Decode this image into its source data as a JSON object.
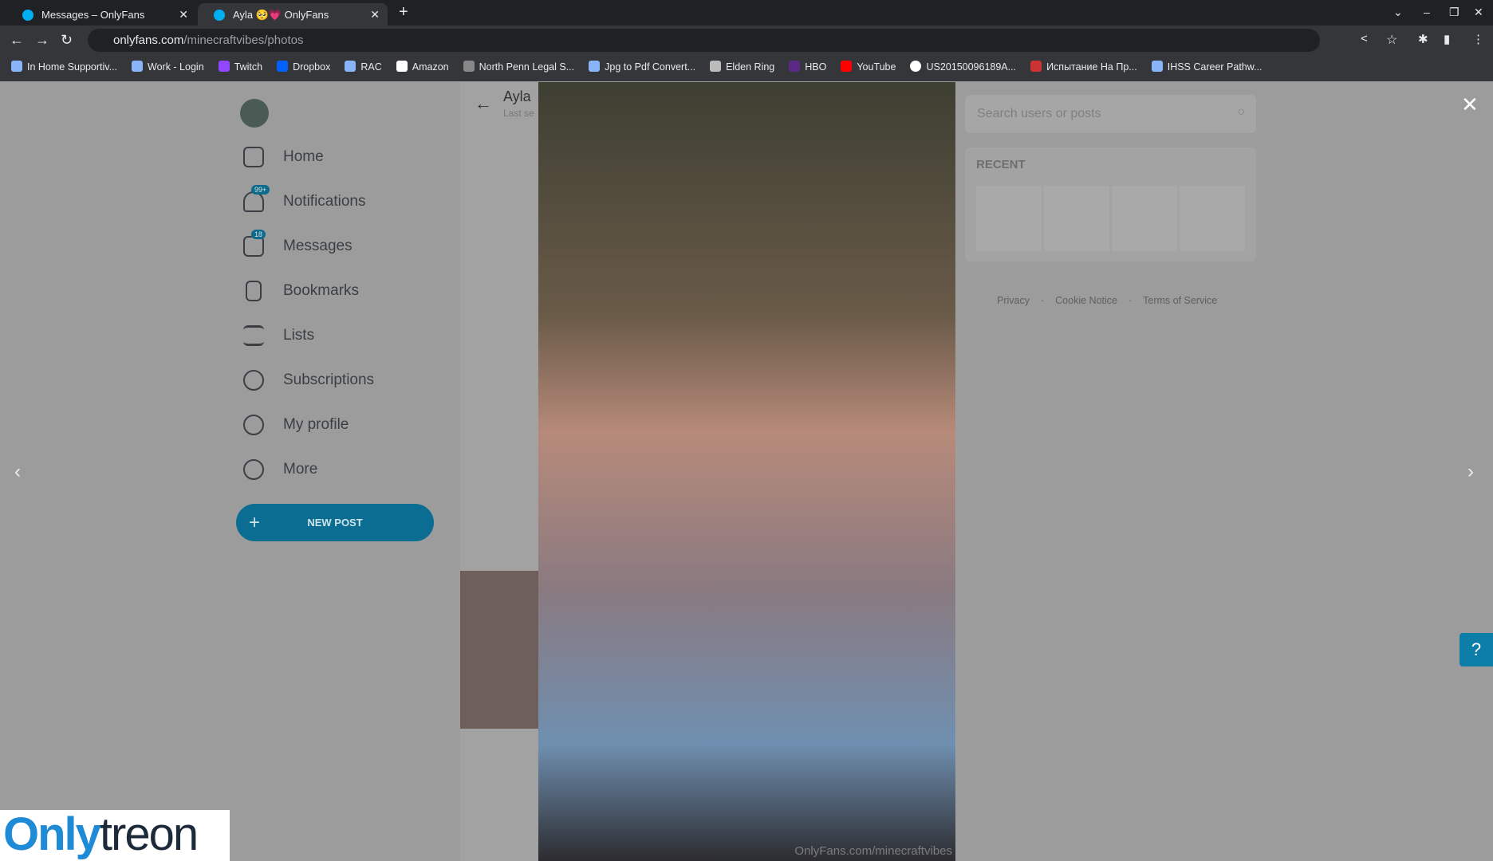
{
  "browser": {
    "tabs": [
      {
        "title": "Messages – OnlyFans"
      },
      {
        "title": "Ayla 🥺💗 OnlyFans"
      }
    ],
    "url_host": "onlyfans.com",
    "url_path": "/minecraftvibes/photos",
    "bookmarks": [
      "In Home Supportiv...",
      "Work - Login",
      "Twitch",
      "Dropbox",
      "RAC",
      "Amazon",
      "North Penn Legal S...",
      "Jpg to Pdf Convert...",
      "Elden Ring",
      "HBO",
      "YouTube",
      "US20150096189A...",
      "Испытание На Пр...",
      "IHSS Career Pathw..."
    ]
  },
  "sidebar": {
    "items": [
      {
        "label": "Home"
      },
      {
        "label": "Notifications",
        "badge": "99+"
      },
      {
        "label": "Messages",
        "badge": "18"
      },
      {
        "label": "Bookmarks"
      },
      {
        "label": "Lists"
      },
      {
        "label": "Subscriptions"
      },
      {
        "label": "My profile"
      },
      {
        "label": "More"
      }
    ],
    "new_post": "NEW POST"
  },
  "profile": {
    "name": "Ayla",
    "status": "Last se"
  },
  "viewer": {
    "watermark": "OnlyFans.com/minecraftvibes"
  },
  "right": {
    "search_placeholder": "Search users or posts",
    "recent_label": "RECENT",
    "footer": [
      "Privacy",
      "Cookie Notice",
      "Terms of Service"
    ]
  },
  "overlay_logo": "Onlytreon",
  "colors": {
    "accent": "#00aff0"
  }
}
